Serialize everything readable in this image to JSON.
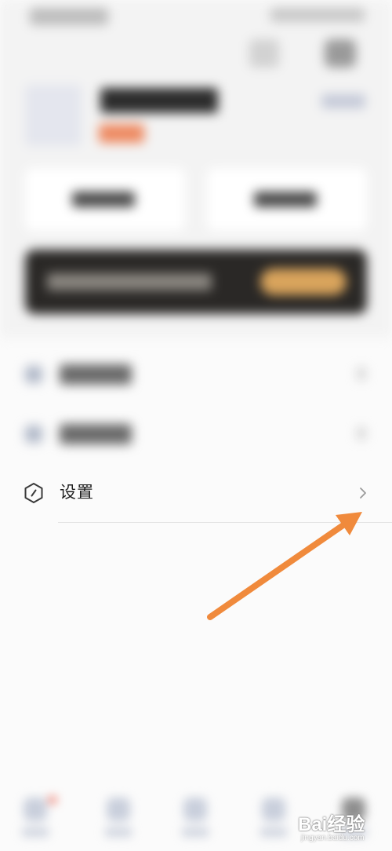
{
  "menu": {
    "settings_label": "设置"
  },
  "icons": {
    "settings": "hexagon-settings-icon",
    "chevron": "chevron-right-icon"
  },
  "annotation": {
    "arrow_color": "#f08a3c"
  },
  "watermark": {
    "brand": "Bai经验",
    "url": "jingyan.baidu.com"
  }
}
